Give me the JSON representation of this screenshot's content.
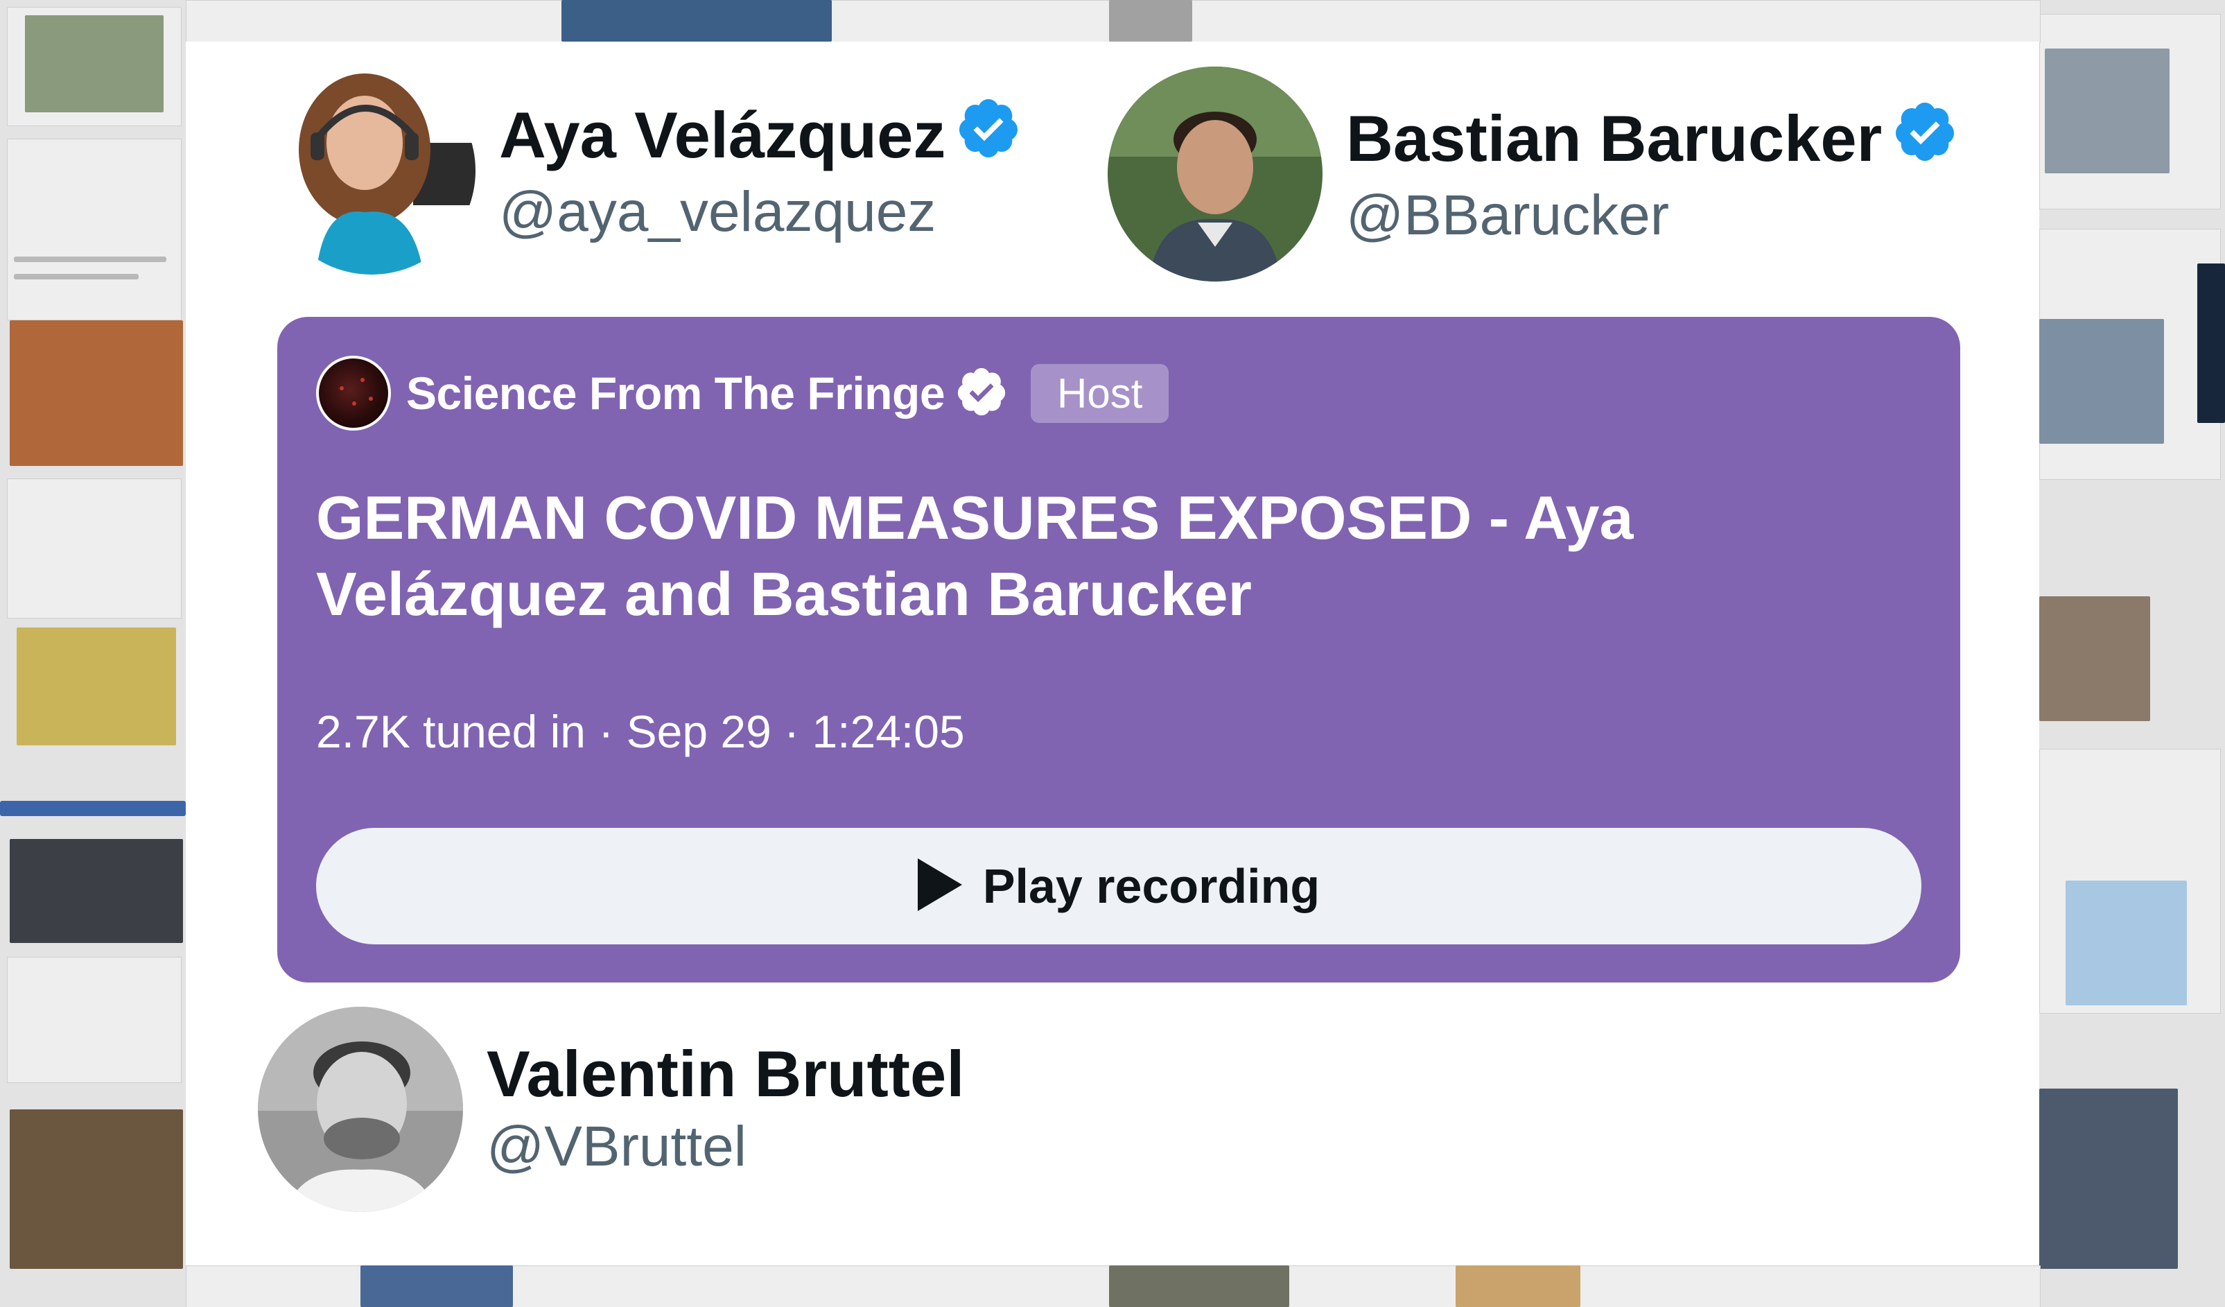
{
  "speakers": [
    {
      "display_name": "Aya Velázquez",
      "handle": "@aya_velazquez",
      "verified": true
    },
    {
      "display_name": "Bastian Barucker",
      "handle": "@BBarucker",
      "verified": true
    },
    {
      "display_name": "Valentin Bruttel",
      "handle": "@VBruttel",
      "verified": false
    }
  ],
  "space": {
    "host_name": "Science From The Fringe",
    "host_verified": true,
    "host_badge": "Host",
    "title": "GERMAN COVID MEASURES EXPOSED - Aya Velázquez and Bastian Barucker",
    "meta": "2.7K tuned in · Sep 29 · 1:24:05",
    "play_label": "Play recording",
    "color": "#8064b2"
  },
  "colors": {
    "verified_blue": "#1d9bf0",
    "handle_gray": "#536471",
    "play_button_bg": "#eef1f5"
  }
}
